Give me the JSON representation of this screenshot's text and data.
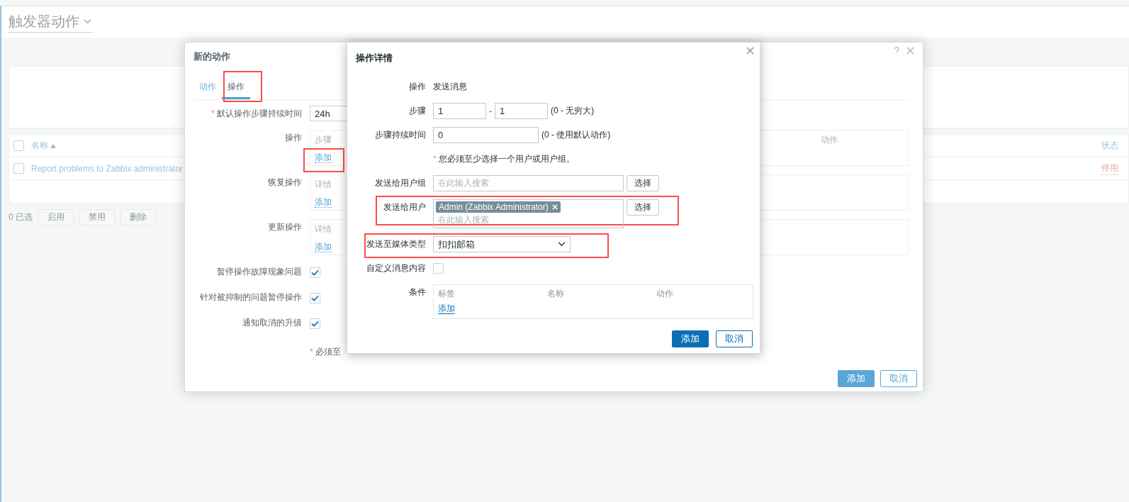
{
  "page": {
    "title": "触发器动作"
  },
  "list": {
    "all_checked": false,
    "columns": [
      {
        "label": "名称",
        "sorted": true
      },
      {
        "label": "状态",
        "sorted": false
      }
    ],
    "rows": [
      {
        "checked": false,
        "name": "Report problems to Zabbix administrator",
        "status": "停用"
      }
    ],
    "selected_count": "0 已选",
    "buttons": [
      {
        "label": "启用",
        "disabled": true
      },
      {
        "label": "禁用",
        "disabled": true
      },
      {
        "label": "删除",
        "disabled": true
      }
    ]
  },
  "action_dialog": {
    "title": "新的动作",
    "tabs": [
      {
        "label": "动作",
        "selected": false
      },
      {
        "label": "操作",
        "selected": true,
        "highlighted": true
      }
    ],
    "duration": {
      "mark": "*",
      "label": "默认操作步骤持续时间",
      "value": "24h"
    },
    "operation_tables": [
      {
        "label": "操作",
        "columns": [
          "步骤",
          "动作"
        ],
        "add_link": "添加",
        "highlighted": true
      },
      {
        "label": "恢复操作",
        "columns": [
          "详情"
        ],
        "add_link": "添加"
      },
      {
        "label": "更新操作",
        "columns": [
          "详情"
        ],
        "add_link": "添加"
      }
    ],
    "options": [
      {
        "label": "暂停操作故障现象问题",
        "checked": true
      },
      {
        "label": "针对被抑制的问题暂停操作",
        "checked": true
      },
      {
        "label": "通知取消的升级",
        "checked": true
      }
    ],
    "note": {
      "mark": "*",
      "text": "必须至"
    },
    "buttons": [
      {
        "label": "添加",
        "kind": "primary"
      },
      {
        "label": "取消",
        "kind": "secondary"
      }
    ]
  },
  "operation_dialog": {
    "title": "操作详情",
    "operation": {
      "label": "操作",
      "value": "发送消息"
    },
    "steps": {
      "label": "步骤",
      "from": "1",
      "separator": "-",
      "to": "1",
      "hint": "(0 - 无穷大)"
    },
    "step_duration": {
      "label": "步骤持续时间",
      "value": "0",
      "hint": "(0 - 使用默认动作)"
    },
    "note": {
      "mark": "*",
      "text": "您必须至少选择一个用户或用户组。"
    },
    "user_groups": {
      "label": "发送给用户组",
      "placeholder": "在此输入搜索",
      "button": "选择"
    },
    "users": {
      "label": "发送给用户",
      "tags": [
        "Admin (Zabbix Administrator)"
      ],
      "placeholder": "在此输入搜索",
      "button": "选择",
      "highlighted": true
    },
    "media_type": {
      "label": "发送至媒体类型",
      "value": "扣扣邮箱",
      "highlighted": true
    },
    "custom_message": {
      "label": "自定义消息内容",
      "checked": false
    },
    "conditions": {
      "label": "条件",
      "columns": [
        "标签",
        "名称",
        "动作"
      ],
      "add_link": "添加"
    },
    "buttons": [
      {
        "label": "添加",
        "kind": "primary"
      },
      {
        "label": "取消",
        "kind": "secondary"
      }
    ]
  }
}
